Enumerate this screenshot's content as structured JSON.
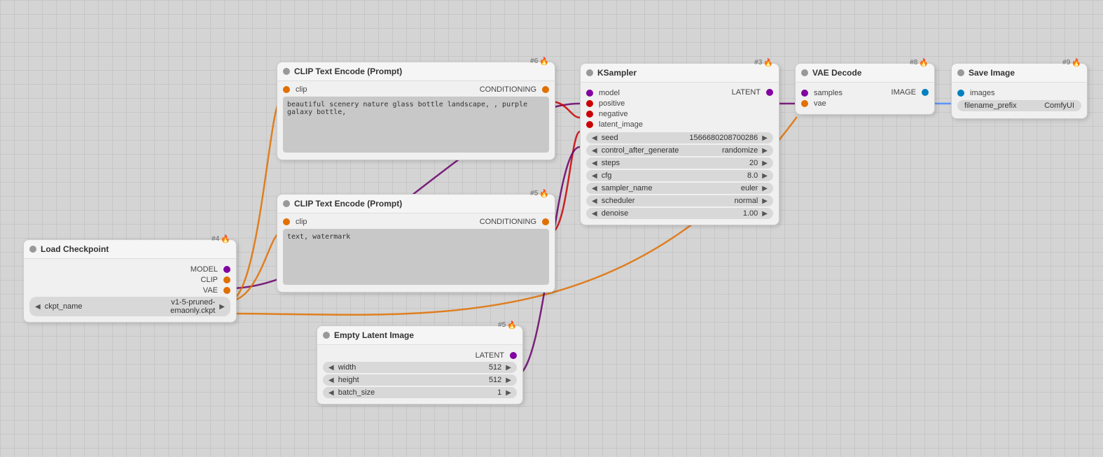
{
  "nodes": {
    "load_checkpoint": {
      "id": "#4",
      "title": "Load Checkpoint",
      "outputs": [
        "MODEL",
        "CLIP",
        "VAE"
      ],
      "params": [
        {
          "name": "ckpt_name",
          "value": "v1-5-pruned-emaonly.ckpt"
        }
      ]
    },
    "clip_text_encode_1": {
      "id": "#6",
      "title": "CLIP Text Encode (Prompt)",
      "input_port": "clip",
      "output_port": "CONDITIONING",
      "text": "beautiful scenery nature glass bottle landscape, , purple galaxy bottle,"
    },
    "clip_text_encode_2": {
      "id": "#5",
      "title": "CLIP Text Encode (Prompt)",
      "input_port": "clip",
      "output_port": "CONDITIONING",
      "text": "text, watermark"
    },
    "empty_latent": {
      "id": "#5",
      "title": "Empty Latent Image",
      "output_port": "LATENT",
      "params": [
        {
          "name": "width",
          "value": "512"
        },
        {
          "name": "height",
          "value": "512"
        },
        {
          "name": "batch_size",
          "value": "1"
        }
      ]
    },
    "ksampler": {
      "id": "#3",
      "title": "KSampler",
      "inputs": [
        "model",
        "positive",
        "negative",
        "latent_image"
      ],
      "output_port": "LATENT",
      "params": [
        {
          "name": "seed",
          "value": "1566680208700286"
        },
        {
          "name": "control_after_generate",
          "value": "randomize"
        },
        {
          "name": "steps",
          "value": "20"
        },
        {
          "name": "cfg",
          "value": "8.0"
        },
        {
          "name": "sampler_name",
          "value": "euler"
        },
        {
          "name": "scheduler",
          "value": "normal"
        },
        {
          "name": "denoise",
          "value": "1.00"
        }
      ]
    },
    "vae_decode": {
      "id": "#8",
      "title": "VAE Decode",
      "inputs": [
        "samples",
        "vae"
      ],
      "output_port": "IMAGE"
    },
    "save_image": {
      "id": "#9",
      "title": "Save Image",
      "inputs": [
        "images"
      ],
      "params": [
        {
          "name": "filename_prefix",
          "value": "ComfyUI"
        }
      ]
    }
  }
}
